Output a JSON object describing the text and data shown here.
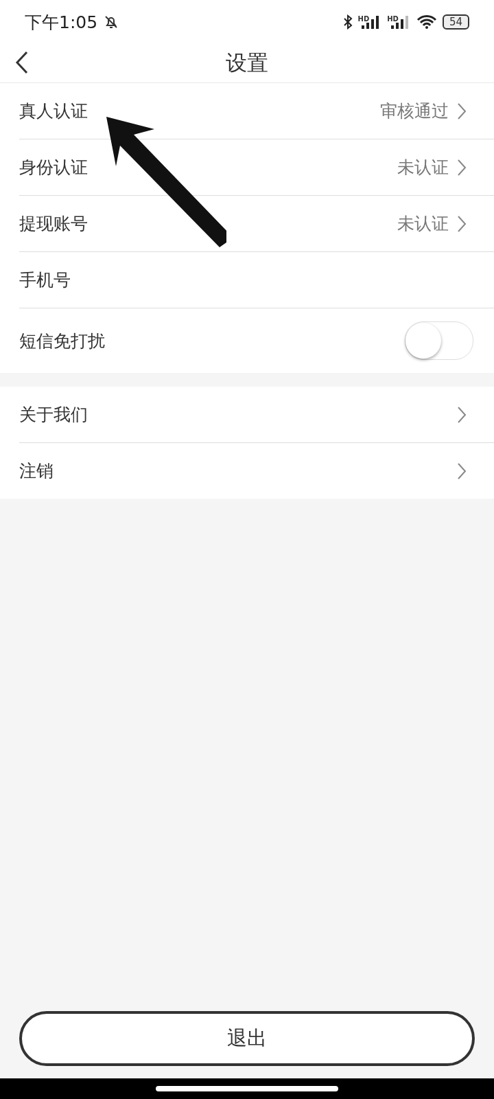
{
  "status_bar": {
    "time": "下午1:05",
    "signal_labels": [
      "HD",
      "HD"
    ],
    "battery": "54"
  },
  "header": {
    "title": "设置"
  },
  "groups": [
    {
      "rows": [
        {
          "kind": "link",
          "label": "真人认证",
          "value": "审核通过"
        },
        {
          "kind": "link",
          "label": "身份认证",
          "value": "未认证"
        },
        {
          "kind": "link",
          "label": "提现账号",
          "value": "未认证"
        },
        {
          "kind": "plain",
          "label": "手机号"
        },
        {
          "kind": "toggle",
          "label": "短信免打扰",
          "on": false
        }
      ]
    },
    {
      "rows": [
        {
          "kind": "link",
          "label": "关于我们"
        },
        {
          "kind": "link",
          "label": "注销"
        }
      ]
    }
  ],
  "logout_button": "退出"
}
